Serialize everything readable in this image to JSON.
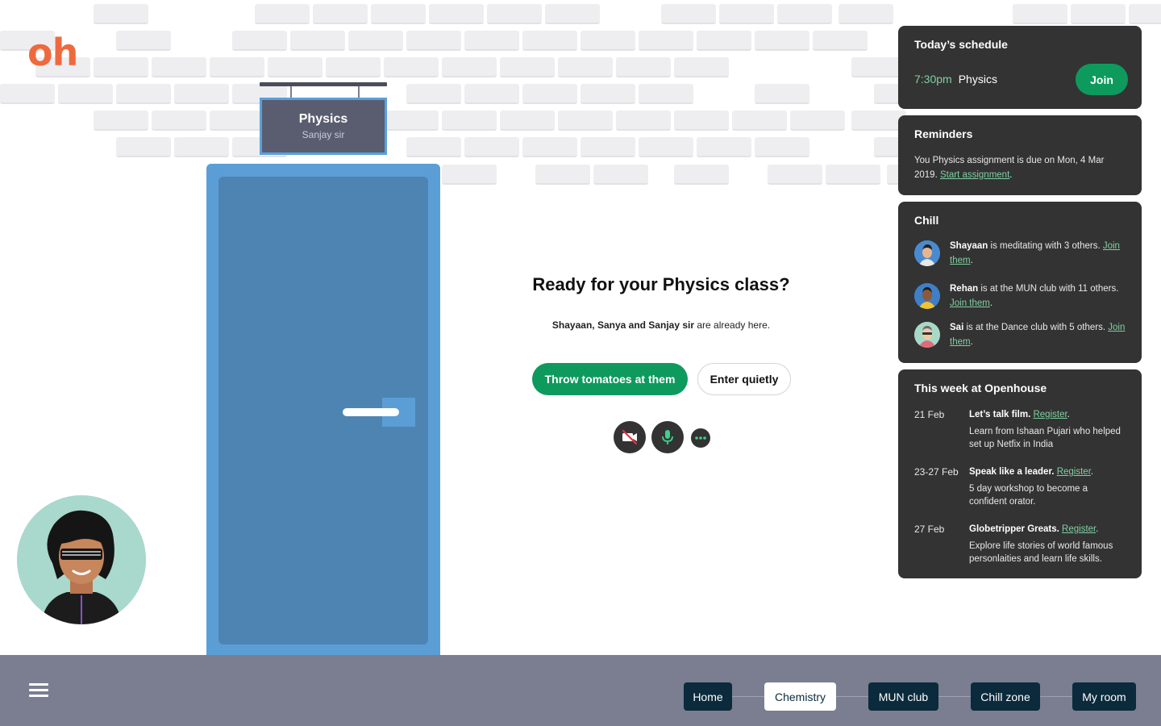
{
  "brand": {
    "logo_text": "oh",
    "logo_color": "#ee6a3e"
  },
  "door": {
    "sign_title": "Physics",
    "sign_subtitle": "Sanjay sir"
  },
  "prompt": {
    "heading": "Ready for your Physics class?",
    "attendees_names": "Shayaan, Sanya and Sanjay sir",
    "attendees_suffix": " are already here.",
    "primary_button": "Throw tomatoes at them",
    "secondary_button": "Enter quietly"
  },
  "controls": [
    {
      "icon": "video-off-icon"
    },
    {
      "icon": "microphone-icon"
    },
    {
      "icon": "more-icon"
    }
  ],
  "schedule": {
    "title": "Today’s schedule",
    "time": "7:30pm",
    "class_name": "Physics",
    "join_label": "Join"
  },
  "reminders": {
    "title": "Reminders",
    "text": "You Physics assignment is due on Mon, 4 Mar 2019.",
    "link": "Start assignment",
    "trailing": "."
  },
  "chill": {
    "title": "Chill",
    "items": [
      {
        "name": "Shayaan",
        "text": " is meditating with 3 others. ",
        "link": "Join them",
        "trailing": "."
      },
      {
        "name": "Rehan",
        "text": " is at the MUN club with 11 others. ",
        "link": "Join them",
        "trailing": "."
      },
      {
        "name": "Sai",
        "text": " is at the Dance club with 5 others. ",
        "link": "Join them",
        "trailing": "."
      }
    ]
  },
  "week": {
    "title": "This week at Openhouse",
    "events": [
      {
        "date": "21 Feb",
        "name": "Let’s talk film.",
        "link": "Register",
        "trailing": ".",
        "desc": "Learn from Ishaan Pujari who helped set up Netfix in India"
      },
      {
        "date": "23-27 Feb",
        "name": "Speak like a leader.",
        "link": "Register",
        "trailing": ".",
        "desc": "5 day workshop to become a confident orator."
      },
      {
        "date": "27 Feb",
        "name": "Globetripper Greats.",
        "link": "Register",
        "trailing": ".",
        "desc": "Explore life stories of world famous personlaities and learn life skills."
      }
    ]
  },
  "nav": {
    "items": [
      {
        "label": "Home",
        "active": false
      },
      {
        "label": "Chemistry",
        "active": true
      },
      {
        "label": "MUN club",
        "active": false
      },
      {
        "label": "Chill zone",
        "active": false
      },
      {
        "label": "My room",
        "active": false
      }
    ]
  },
  "colors": {
    "accent_green": "#0e9a5d",
    "link_green": "#7fd0a2",
    "panel_bg": "#333333",
    "door_blue": "#5b9ed6",
    "nav_dark": "#0b2a3c",
    "bottom_bar": "#7a7e90"
  }
}
